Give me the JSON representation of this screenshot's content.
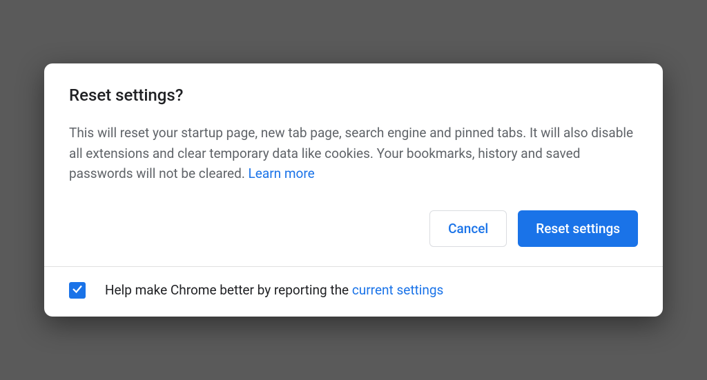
{
  "dialog": {
    "title": "Reset settings?",
    "description": "This will reset your startup page, new tab page, search engine and pinned tabs. It will also disable all extensions and clear temporary data like cookies. Your bookmarks, history and saved passwords will not be cleared. ",
    "learn_more": "Learn more",
    "cancel_label": "Cancel",
    "reset_label": "Reset settings"
  },
  "footer": {
    "text_prefix": "Help make Chrome better by reporting the ",
    "link": "current settings",
    "checkbox_checked": true
  },
  "colors": {
    "primary": "#1a73e8",
    "text": "#202124",
    "muted": "#5f6368"
  }
}
